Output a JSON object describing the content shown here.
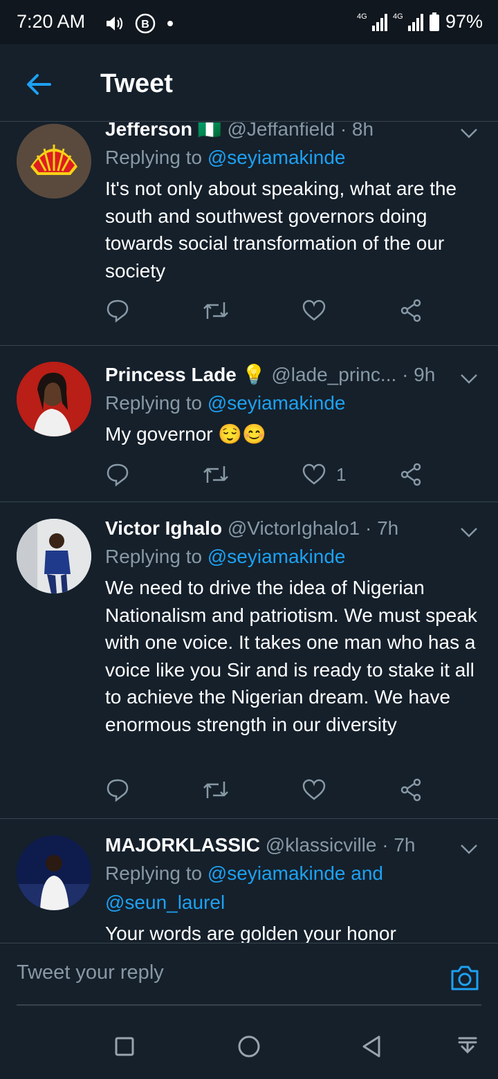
{
  "status_bar": {
    "time": "7:20 AM",
    "battery": "97%",
    "network_1": "4G",
    "network_2": "4G"
  },
  "header": {
    "title": "Tweet"
  },
  "tweets": [
    {
      "name": "Jefferson",
      "flag": "🇳🇬",
      "handle": "@Jeffanfield",
      "time": "· 8h",
      "replying_prefix": "Replying to ",
      "replying_to": "@seyiamakinde",
      "text": "It's not only about speaking, what are the south and southwest governors doing towards social transformation of the our society",
      "likes": ""
    },
    {
      "name": "Princess Lade",
      "emoji": "💡",
      "handle": "@lade_princ...",
      "time": "· 9h",
      "replying_prefix": "Replying to ",
      "replying_to": "@seyiamakinde",
      "text": "My governor 😌😊",
      "likes": "1"
    },
    {
      "name": "Victor Ighalo",
      "handle": "@VictorIghalo1",
      "time": "· 7h",
      "replying_prefix": "Replying to ",
      "replying_to": "@seyiamakinde",
      "text": "We need to drive the idea of Nigerian Nationalism and patriotism. We must speak with one voice. It takes one man who has a voice like you Sir and is ready to stake it all to achieve the Nigerian dream. We have enormous strength in our diversity",
      "likes": ""
    },
    {
      "name": "MAJORKLASSIC",
      "handle": "@klassicville",
      "time": "· 7h",
      "replying_prefix": "Replying to ",
      "replying_to": "@seyiamakinde and @seun_laurel",
      "text": "Your words are golden your honor",
      "likes": ""
    }
  ],
  "composer": {
    "placeholder": "Tweet your reply"
  },
  "colors": {
    "background": "#15202b",
    "accent": "#1da1f2",
    "secondary_text": "#8899a6",
    "divider": "#38444d"
  },
  "icons": [
    "back-arrow-icon",
    "reply-icon",
    "retweet-icon",
    "like-icon",
    "share-icon",
    "chevron-down-icon",
    "camera-icon",
    "nav-recents-icon",
    "nav-home-icon",
    "nav-back-icon",
    "nav-notifications-icon"
  ]
}
